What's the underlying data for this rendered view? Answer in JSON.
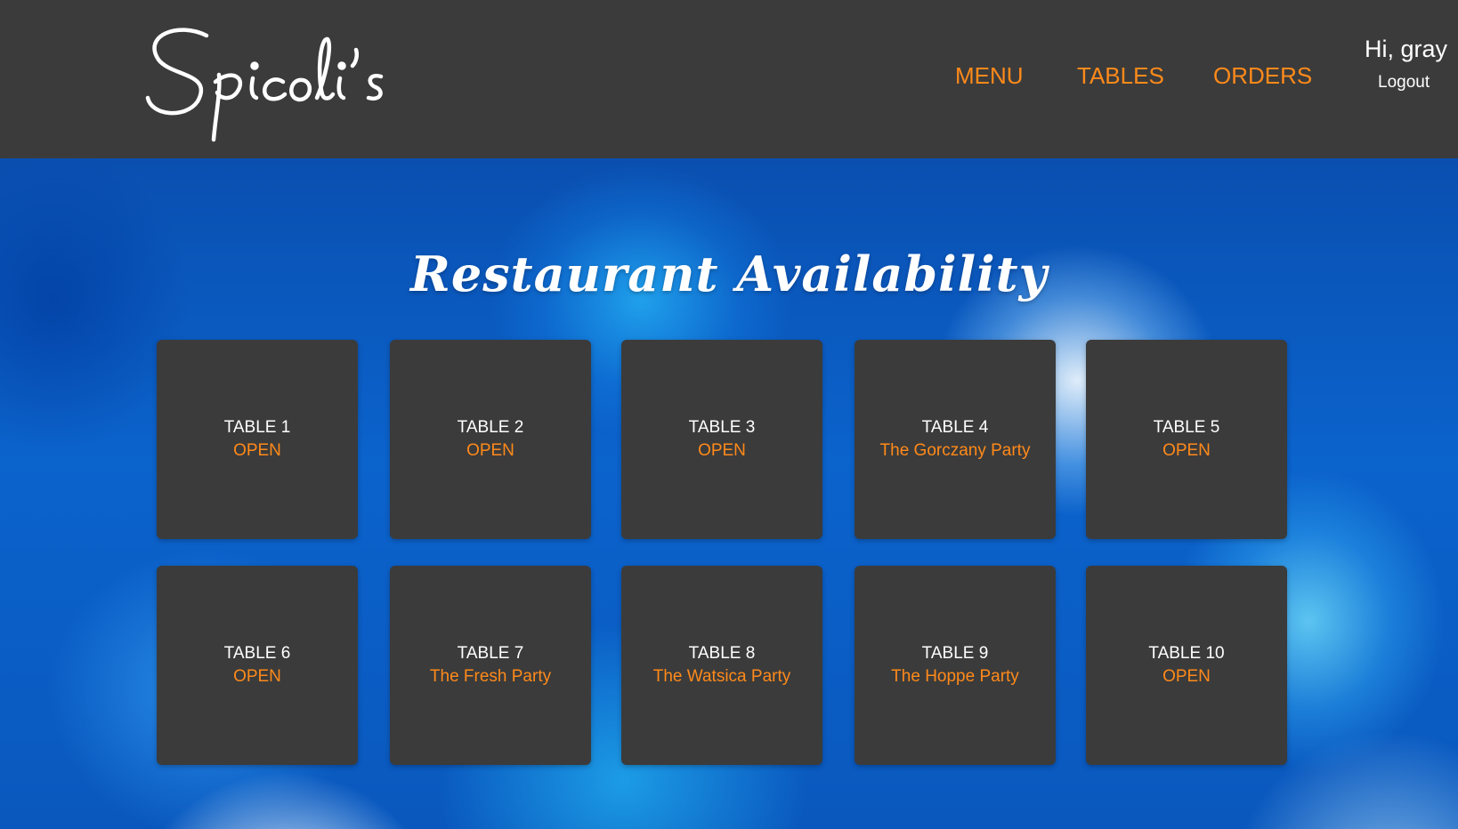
{
  "brand": {
    "name": "Spicoli's"
  },
  "nav": {
    "items": [
      {
        "label": "MENU"
      },
      {
        "label": "TABLES"
      },
      {
        "label": "ORDERS"
      }
    ]
  },
  "user": {
    "greeting": "Hi, gray",
    "logout_label": "Logout"
  },
  "main": {
    "title": "Restaurant Availability",
    "tables": [
      {
        "name": "TABLE 1",
        "status": "OPEN"
      },
      {
        "name": "TABLE 2",
        "status": "OPEN"
      },
      {
        "name": "TABLE 3",
        "status": "OPEN"
      },
      {
        "name": "TABLE 4",
        "status": "The Gorczany Party"
      },
      {
        "name": "TABLE 5",
        "status": "OPEN"
      },
      {
        "name": "TABLE 6",
        "status": "OPEN"
      },
      {
        "name": "TABLE 7",
        "status": "The Fresh Party"
      },
      {
        "name": "TABLE 8",
        "status": "The Watsica Party"
      },
      {
        "name": "TABLE 9",
        "status": "The Hoppe Party"
      },
      {
        "name": "TABLE 10",
        "status": "OPEN"
      }
    ]
  },
  "colors": {
    "header_bg": "#3b3b3b",
    "accent": "#ff8a1a",
    "card_bg": "#3b3b3b",
    "text": "#ffffff"
  }
}
